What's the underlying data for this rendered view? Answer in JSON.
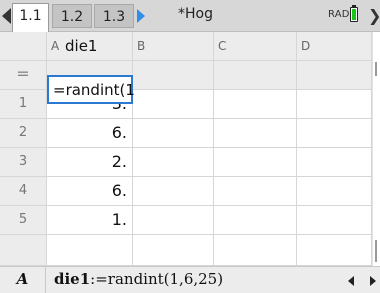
{
  "tabs": [
    {
      "label": "1.1",
      "active": true
    },
    {
      "label": "1.2",
      "active": false
    },
    {
      "label": "1.3",
      "active": false
    }
  ],
  "document_title": "*Hog",
  "angle_mode": "RAD",
  "columns": [
    {
      "letter": "A",
      "name": "die1"
    },
    {
      "letter": "B",
      "name": ""
    },
    {
      "letter": "C",
      "name": ""
    },
    {
      "letter": "D",
      "name": ""
    }
  ],
  "formula_row": {
    "marker": "=",
    "formula": "=randint(1"
  },
  "rows": [
    {
      "num": "1",
      "values": [
        "3.",
        "",
        "",
        ""
      ]
    },
    {
      "num": "2",
      "values": [
        "6.",
        "",
        "",
        ""
      ]
    },
    {
      "num": "3",
      "values": [
        "2.",
        "",
        "",
        ""
      ]
    },
    {
      "num": "4",
      "values": [
        "6.",
        "",
        "",
        ""
      ]
    },
    {
      "num": "5",
      "values": [
        "1.",
        "",
        "",
        ""
      ]
    }
  ],
  "bottom_bar": {
    "cell_ref": "A",
    "expr_name": "die1",
    "expr_body": ":=randint(1,6,25)"
  },
  "colors": {
    "accent": "#2f8ee5",
    "selection": "#2b79d1",
    "battery": "#19c51a"
  }
}
